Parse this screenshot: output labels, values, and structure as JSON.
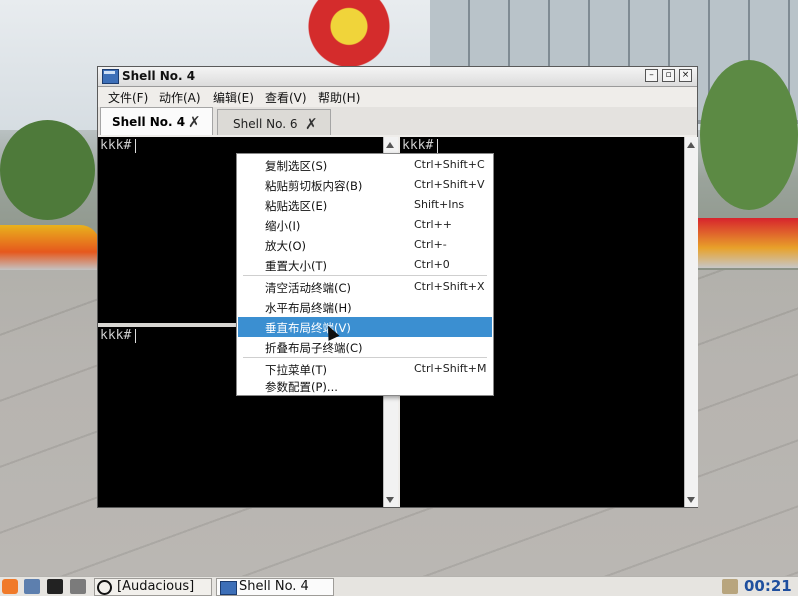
{
  "window": {
    "title": "Shell No. 4",
    "buttons": {
      "minimize": "–",
      "maximize": "▫",
      "close": "×"
    }
  },
  "menubar": {
    "items": [
      "文件(F)",
      "动作(A)",
      "编辑(E)",
      "查看(V)",
      "帮助(H)"
    ]
  },
  "tabs": [
    {
      "label": "Shell No. 4",
      "active": true,
      "close": "✗"
    },
    {
      "label": "Shell No. 6",
      "active": false,
      "close": "✗"
    }
  ],
  "terminals": {
    "prompt": "kkk#"
  },
  "context_menu": {
    "items": [
      {
        "label": "复制选区(S)",
        "accel": "Ctrl+Shift+C"
      },
      {
        "label": "粘贴剪切板内容(B)",
        "accel": "Ctrl+Shift+V"
      },
      {
        "label": "粘贴选区(E)",
        "accel": "Shift+Ins"
      },
      {
        "label": "缩小(I)",
        "accel": "Ctrl++"
      },
      {
        "label": "放大(O)",
        "accel": "Ctrl+-"
      },
      {
        "label": "重置大小(T)",
        "accel": "Ctrl+0"
      },
      {
        "label": "清空活动终端(C)",
        "accel": "Ctrl+Shift+X"
      },
      {
        "label": "水平布局终端(H)",
        "accel": ""
      },
      {
        "label": "垂直布局终端(V)",
        "accel": "",
        "highlighted": true
      },
      {
        "label": "折叠布局子终端(C)",
        "accel": ""
      },
      {
        "label": "下拉菜单(T)",
        "accel": "Ctrl+Shift+M"
      },
      {
        "label": "参数配置(P)...",
        "accel": ""
      }
    ],
    "highlight_color": "#3b8fd1"
  },
  "taskbar": {
    "tasks": [
      "[Audacious]",
      "Shell No. 4"
    ],
    "clock": "00:21",
    "icons": [
      "start-menu-icon",
      "file-manager-icon",
      "terminal-icon",
      "show-desktop-icon",
      "audacious-icon"
    ]
  }
}
